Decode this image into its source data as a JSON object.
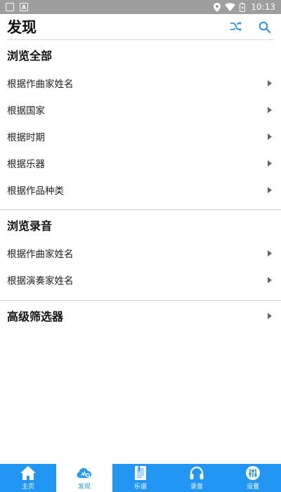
{
  "status_bar": {
    "time": "10:13",
    "left_icons": [
      "notification-box-icon",
      "font-a-icon"
    ],
    "right_icons": [
      "location-icon",
      "wifi-icon",
      "battery-icon"
    ]
  },
  "header": {
    "title": "发现",
    "actions": [
      "shuffle-icon",
      "search-icon"
    ],
    "accent_color": "#2196f3"
  },
  "sections": [
    {
      "title": "浏览全部",
      "items": [
        "根据作曲家姓名",
        "根据国家",
        "根据时期",
        "根据乐器",
        "根据作品种类"
      ]
    },
    {
      "title": "浏览录音",
      "items": [
        "根据作曲家姓名",
        "根据演奏家姓名"
      ]
    }
  ],
  "advanced_filter": {
    "label": "高级筛选器"
  },
  "tab_bar": {
    "background": "#2196f3",
    "active_index": 1,
    "tabs": [
      {
        "label": "主页",
        "icon": "home-icon"
      },
      {
        "label": "发现",
        "icon": "discover-cloud-icon"
      },
      {
        "label": "乐谱",
        "icon": "sheet-music-icon"
      },
      {
        "label": "录音",
        "icon": "headphones-icon"
      },
      {
        "label": "设置",
        "icon": "settings-sliders-icon"
      }
    ]
  }
}
